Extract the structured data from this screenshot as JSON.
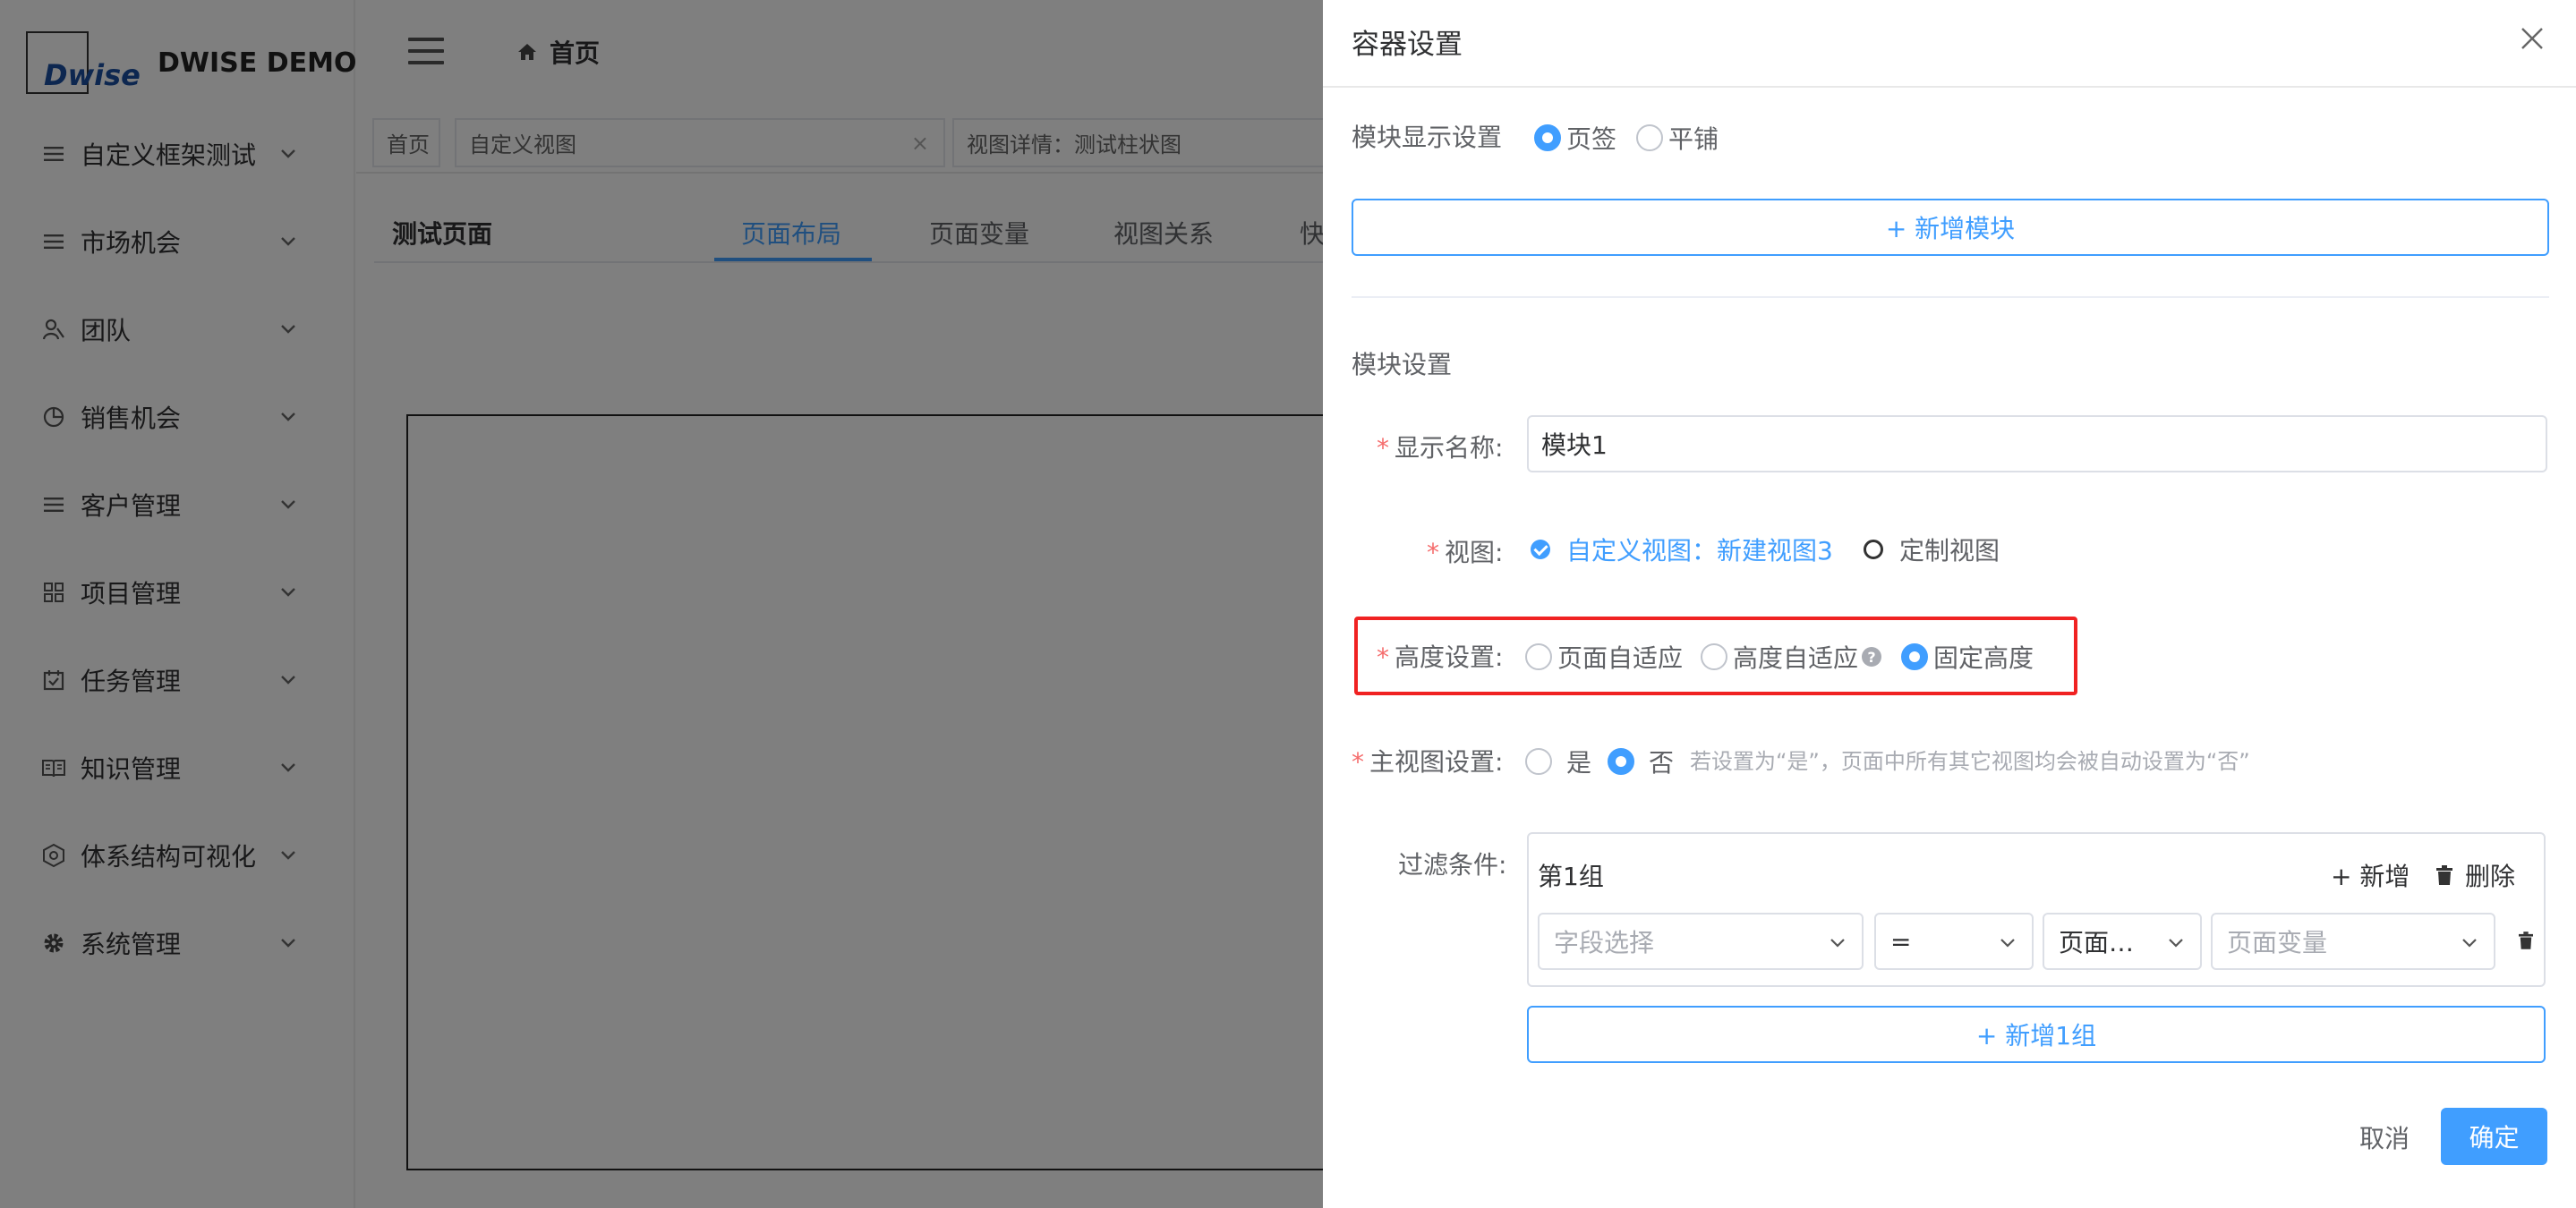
{
  "app": {
    "logo_text": "Dwise",
    "title": "DWISE DEMO"
  },
  "sidebar": {
    "items": [
      {
        "label": "自定义框架测试",
        "icon": "list-icon"
      },
      {
        "label": "市场机会",
        "icon": "list-icon"
      },
      {
        "label": "团队",
        "icon": "team-icon"
      },
      {
        "label": "销售机会",
        "icon": "pie-icon"
      },
      {
        "label": "客户管理",
        "icon": "list-icon"
      },
      {
        "label": "项目管理",
        "icon": "grid-icon"
      },
      {
        "label": "任务管理",
        "icon": "calendar-check-icon"
      },
      {
        "label": "知识管理",
        "icon": "book-icon"
      },
      {
        "label": "体系结构可视化",
        "icon": "hexagon-icon"
      },
      {
        "label": "系统管理",
        "icon": "gear-icon"
      }
    ]
  },
  "header": {
    "breadcrumb": "首页"
  },
  "tags": [
    {
      "label": "首页"
    },
    {
      "label": "自定义视图"
    },
    {
      "label": "视图详情：测试柱状图"
    }
  ],
  "page": {
    "title": "测试页面",
    "tabs": [
      "页面布局",
      "页面变量",
      "视图关系",
      "快"
    ],
    "active_tab": "页面布局"
  },
  "drawer": {
    "title": "容器设置",
    "module_display": {
      "label": "模块显示设置",
      "options": [
        "页签",
        "平铺"
      ],
      "selected": "页签"
    },
    "add_module_button": "+ 新增模块",
    "module_settings_heading": "模块设置",
    "display_name": {
      "label": "显示名称:",
      "value": "模块1"
    },
    "view": {
      "label": "视图:",
      "selected_option": "自定义视图：新建视图3",
      "other_option": "定制视图"
    },
    "height": {
      "label": "高度设置:",
      "options": [
        "页面自适应",
        "高度自适应",
        "固定高度"
      ],
      "selected": "固定高度"
    },
    "main_view": {
      "label": "主视图设置:",
      "options": [
        "是",
        "否"
      ],
      "selected": "否",
      "hint": "若设置为“是”，页面中所有其它视图均会被自动设置为“否”"
    },
    "filter": {
      "label": "过滤条件:",
      "group_title": "第1组",
      "add_label": "+ 新增",
      "delete_label": "删除",
      "field_placeholder": "字段选择",
      "operator_value": "=",
      "source_value": "页面…",
      "variable_placeholder": "页面变量",
      "add_group_button": "+ 新增1组"
    },
    "cancel_label": "取消",
    "confirm_label": "确定"
  },
  "colors": {
    "primary": "#409eff",
    "required": "#f56c6c",
    "highlight_border": "#f02222"
  }
}
